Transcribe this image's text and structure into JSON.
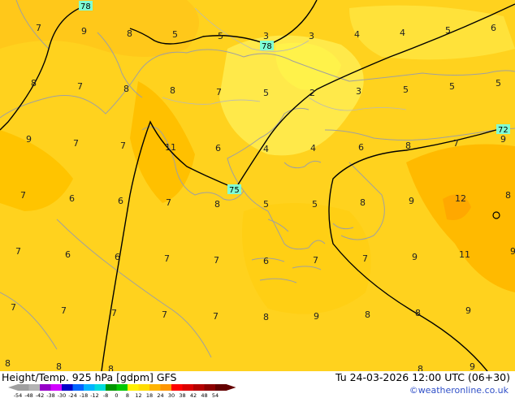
{
  "title": "Height/Temp. 925 hPa [gdpm] GFS",
  "datetime": "Tu 24-03-2026 12:00 UTC (06+30)",
  "credit": "©weatheronline.co.uk",
  "colorbar": {
    "ticks": [
      "-54",
      "-48",
      "-42",
      "-38",
      "-30",
      "-24",
      "-18",
      "-12",
      "-8",
      "0",
      "8",
      "12",
      "18",
      "24",
      "30",
      "38",
      "42",
      "48",
      "54"
    ],
    "colors": [
      "#a0a0a0",
      "#b4b4b4",
      "#9600c8",
      "#d200ff",
      "#0000c8",
      "#0064ff",
      "#00b4ff",
      "#00dcdc",
      "#009600",
      "#00c800",
      "#fff000",
      "#ffdc00",
      "#ffb400",
      "#ff9600",
      "#ff0000",
      "#dc0000",
      "#b40000",
      "#8c0000",
      "#640000"
    ]
  },
  "contour_labels": [
    "78",
    "78",
    "72",
    "75"
  ],
  "temperature_labels": [
    "7",
    "9",
    "8",
    "5",
    "5",
    "3",
    "3",
    "4",
    "4",
    "5",
    "6",
    "8",
    "7",
    "8",
    "8",
    "7",
    "5",
    "2",
    "3",
    "5",
    "5",
    "5",
    "9",
    "7",
    "7",
    "11",
    "6",
    "4",
    "4",
    "6",
    "8",
    "7",
    "9",
    "7",
    "6",
    "6",
    "7",
    "8",
    "5",
    "5",
    "8",
    "9",
    "12",
    "8",
    "7",
    "6",
    "6",
    "7",
    "7",
    "6",
    "7",
    "7",
    "9",
    "11",
    "9",
    "7",
    "7",
    "7",
    "7",
    "7",
    "8",
    "9",
    "8",
    "8",
    "9",
    "8",
    "8",
    "8",
    "8",
    "9"
  ],
  "field_colors": {
    "base": "#ffd21e",
    "light": "#ffe94a",
    "lighter": "#fff24a",
    "warm": "#ffc400",
    "warmer": "#ffb800",
    "sea": "#ffcd14"
  }
}
